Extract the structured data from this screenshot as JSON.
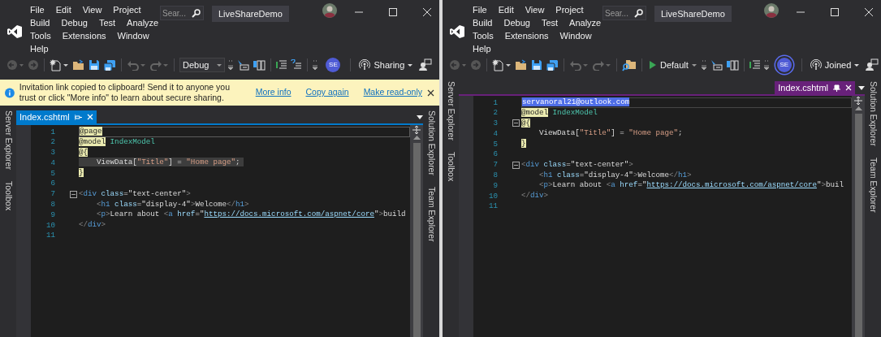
{
  "windows": [
    {
      "menu_rows": [
        [
          "File",
          "Edit",
          "View",
          "Project"
        ],
        [
          "Build",
          "Debug",
          "Test",
          "Analyze"
        ],
        [
          "Tools",
          "Extensions",
          "Window"
        ],
        [
          "Help"
        ]
      ],
      "search": {
        "placeholder": "Sear..."
      },
      "title": "LiveShareDemo",
      "toolbar": [
        {
          "kind": "back"
        },
        {
          "kind": "forward"
        },
        {
          "kind": "sep"
        },
        {
          "kind": "new-item"
        },
        {
          "kind": "open"
        },
        {
          "kind": "save"
        },
        {
          "kind": "save-all"
        },
        {
          "kind": "sep"
        },
        {
          "kind": "undo"
        },
        {
          "kind": "redo"
        },
        {
          "kind": "sep"
        },
        {
          "kind": "config",
          "label": "Debug"
        },
        {
          "kind": "overflow"
        },
        {
          "kind": "cursor"
        },
        {
          "kind": "columns"
        },
        {
          "kind": "sep"
        },
        {
          "kind": "lines"
        },
        {
          "kind": "lines-query"
        },
        {
          "kind": "sep"
        },
        {
          "kind": "overflow"
        },
        {
          "kind": "avatar",
          "label": "SE",
          "ringed": false
        },
        {
          "kind": "sep"
        },
        {
          "kind": "share",
          "label": "Sharing"
        },
        {
          "kind": "feedback"
        }
      ],
      "infobar": {
        "message": "Invitation link copied to clipboard! Send it to anyone you trust or click \"More info\" to learn about secure sharing.",
        "links": [
          "More info",
          "Copy again",
          "Make read-only"
        ]
      },
      "left_tools": [
        "Server Explorer",
        "Toolbox"
      ],
      "right_tools": [
        "Solution Explorer",
        "Team Explorer"
      ],
      "tab": {
        "label": "Index.cshtml",
        "color": "#007acc",
        "pinned": false
      },
      "lines": [
        {
          "number": "1",
          "current": true,
          "highlighted": false,
          "fold": false,
          "tokens": [
            {
              "kind": "razor",
              "text": "@page"
            }
          ]
        },
        {
          "number": "2",
          "current": false,
          "highlighted": false,
          "fold": false,
          "tokens": [
            {
              "kind": "razor",
              "text": "@model"
            },
            {
              "kind": "type",
              "text": " IndexModel"
            }
          ]
        },
        {
          "number": "3",
          "current": false,
          "highlighted": false,
          "fold": false,
          "tokens": [
            {
              "kind": "razor",
              "text": "@{"
            }
          ]
        },
        {
          "number": "4",
          "current": false,
          "highlighted": true,
          "fold": false,
          "tokens": [
            {
              "kind": "plain",
              "text": "    ViewData["
            },
            {
              "kind": "string",
              "text": "\"Title\""
            },
            {
              "kind": "plain",
              "text": "] = "
            },
            {
              "kind": "string",
              "text": "\"Home page\""
            },
            {
              "kind": "plain",
              "text": ";"
            }
          ]
        },
        {
          "number": "5",
          "current": false,
          "highlighted": false,
          "fold": false,
          "tokens": [
            {
              "kind": "razor",
              "text": "}"
            }
          ]
        },
        {
          "number": "6",
          "current": false,
          "highlighted": false,
          "fold": false
        },
        {
          "number": "7",
          "current": false,
          "highlighted": false,
          "fold": true,
          "tokens": [
            {
              "kind": "punct",
              "text": "<"
            },
            {
              "kind": "tag",
              "text": "div"
            },
            {
              "kind": "attr",
              "text": " class"
            },
            {
              "kind": "plain",
              "text": "=\"text-center\""
            },
            {
              "kind": "punct",
              "text": ">"
            }
          ]
        },
        {
          "number": "8",
          "current": false,
          "highlighted": false,
          "fold": false,
          "tokens": [
            {
              "kind": "punct",
              "text": "    <"
            },
            {
              "kind": "tag",
              "text": "h1"
            },
            {
              "kind": "attr",
              "text": " class"
            },
            {
              "kind": "plain",
              "text": "=\"display-4\""
            },
            {
              "kind": "punct",
              "text": ">"
            },
            {
              "kind": "plain",
              "text": "Welcome"
            },
            {
              "kind": "punct",
              "text": "</"
            },
            {
              "kind": "tag",
              "text": "h1"
            },
            {
              "kind": "punct",
              "text": ">"
            }
          ]
        },
        {
          "number": "9",
          "current": false,
          "highlighted": false,
          "fold": false,
          "tokens": [
            {
              "kind": "punct",
              "text": "    <"
            },
            {
              "kind": "tag",
              "text": "p"
            },
            {
              "kind": "punct",
              "text": ">"
            },
            {
              "kind": "plain",
              "text": "Learn about "
            },
            {
              "kind": "punct",
              "text": "<"
            },
            {
              "kind": "tag",
              "text": "a"
            },
            {
              "kind": "attr",
              "text": " href"
            },
            {
              "kind": "plain",
              "text": "=\""
            },
            {
              "kind": "link",
              "text": "https://docs.microsoft.com/aspnet/core"
            },
            {
              "kind": "plain",
              "text": "\""
            },
            {
              "kind": "punct",
              "text": ">"
            },
            {
              "kind": "plain",
              "text": "build"
            }
          ]
        },
        {
          "number": "10",
          "current": false,
          "highlighted": false,
          "fold": false,
          "tokens": [
            {
              "kind": "punct",
              "text": "</"
            },
            {
              "kind": "tag",
              "text": "div"
            },
            {
              "kind": "punct",
              "text": ">"
            }
          ]
        },
        {
          "number": "11",
          "current": false,
          "highlighted": false,
          "fold": false
        }
      ]
    },
    {
      "menu_rows": [
        [
          "File",
          "Edit",
          "View",
          "Project"
        ],
        [
          "Build",
          "Debug",
          "Test",
          "Analyze"
        ],
        [
          "Tools",
          "Extensions",
          "Window"
        ],
        [
          "Help"
        ]
      ],
      "search": {
        "placeholder": "Sear..."
      },
      "title": "LiveShareDemo",
      "toolbar": [
        {
          "kind": "back"
        },
        {
          "kind": "forward"
        },
        {
          "kind": "sep"
        },
        {
          "kind": "new-item"
        },
        {
          "kind": "open"
        },
        {
          "kind": "save"
        },
        {
          "kind": "save-all"
        },
        {
          "kind": "sep"
        },
        {
          "kind": "undo"
        },
        {
          "kind": "redo"
        },
        {
          "kind": "sep"
        },
        {
          "kind": "find"
        },
        {
          "kind": "sep"
        },
        {
          "kind": "run",
          "label": "Default"
        },
        {
          "kind": "overflow"
        },
        {
          "kind": "cursor"
        },
        {
          "kind": "columns"
        },
        {
          "kind": "sep"
        },
        {
          "kind": "lines"
        },
        {
          "kind": "overflow"
        },
        {
          "kind": "avatar",
          "label": "SE",
          "ringed": true
        },
        {
          "kind": "sep"
        },
        {
          "kind": "share",
          "label": "Joined"
        },
        {
          "kind": "feedback"
        }
      ],
      "left_tools": [
        "Server Explorer",
        "Toolbox"
      ],
      "right_tools": [
        "Solution Explorer",
        "Team Explorer"
      ],
      "tab": {
        "label": "Index.cshtml",
        "color": "#68217a",
        "pinned": true
      },
      "lines": [
        {
          "number": "1",
          "current": true,
          "highlighted": false,
          "fold": false,
          "tokens": [
            {
              "kind": "presence",
              "text": "servanoral21@outlook.com"
            }
          ]
        },
        {
          "number": "2",
          "current": false,
          "highlighted": false,
          "fold": false,
          "tokens": [
            {
              "kind": "razor",
              "text": "@model"
            },
            {
              "kind": "type",
              "text": " IndexModel"
            }
          ]
        },
        {
          "number": "3",
          "current": false,
          "highlighted": false,
          "fold": true,
          "tokens": [
            {
              "kind": "razor",
              "text": "@{"
            }
          ]
        },
        {
          "number": "4",
          "current": false,
          "highlighted": false,
          "fold": false,
          "tokens": [
            {
              "kind": "plain",
              "text": "    ViewData["
            },
            {
              "kind": "string",
              "text": "\"Title\""
            },
            {
              "kind": "plain",
              "text": "] = "
            },
            {
              "kind": "string",
              "text": "\"Home page\""
            },
            {
              "kind": "plain",
              "text": ";"
            }
          ]
        },
        {
          "number": "5",
          "current": false,
          "highlighted": false,
          "fold": false,
          "tokens": [
            {
              "kind": "razor",
              "text": "}"
            }
          ]
        },
        {
          "number": "6",
          "current": false,
          "highlighted": false,
          "fold": false
        },
        {
          "number": "7",
          "current": false,
          "highlighted": false,
          "fold": true,
          "tokens": [
            {
              "kind": "punct",
              "text": "<"
            },
            {
              "kind": "tag",
              "text": "div"
            },
            {
              "kind": "attr",
              "text": " class"
            },
            {
              "kind": "plain",
              "text": "=\"text-center\""
            },
            {
              "kind": "punct",
              "text": ">"
            }
          ]
        },
        {
          "number": "8",
          "current": false,
          "highlighted": false,
          "fold": false,
          "tokens": [
            {
              "kind": "punct",
              "text": "    <"
            },
            {
              "kind": "tag",
              "text": "h1"
            },
            {
              "kind": "attr",
              "text": " class"
            },
            {
              "kind": "plain",
              "text": "=\"display-4\""
            },
            {
              "kind": "punct",
              "text": ">"
            },
            {
              "kind": "plain",
              "text": "Welcome"
            },
            {
              "kind": "punct",
              "text": "</"
            },
            {
              "kind": "tag",
              "text": "h1"
            },
            {
              "kind": "punct",
              "text": ">"
            }
          ]
        },
        {
          "number": "9",
          "current": false,
          "highlighted": false,
          "fold": false,
          "tokens": [
            {
              "kind": "punct",
              "text": "    <"
            },
            {
              "kind": "tag",
              "text": "p"
            },
            {
              "kind": "punct",
              "text": ">"
            },
            {
              "kind": "plain",
              "text": "Learn about "
            },
            {
              "kind": "punct",
              "text": "<"
            },
            {
              "kind": "tag",
              "text": "a"
            },
            {
              "kind": "attr",
              "text": " href"
            },
            {
              "kind": "plain",
              "text": "=\""
            },
            {
              "kind": "link",
              "text": "https://docs.microsoft.com/aspnet/core"
            },
            {
              "kind": "plain",
              "text": "\""
            },
            {
              "kind": "punct",
              "text": ">"
            },
            {
              "kind": "plain",
              "text": "buil"
            }
          ]
        },
        {
          "number": "10",
          "current": false,
          "highlighted": false,
          "fold": false,
          "tokens": [
            {
              "kind": "punct",
              "text": "</"
            },
            {
              "kind": "tag",
              "text": "div"
            },
            {
              "kind": "punct",
              "text": ">"
            }
          ]
        },
        {
          "number": "11",
          "current": false,
          "highlighted": false,
          "fold": false
        }
      ]
    }
  ]
}
